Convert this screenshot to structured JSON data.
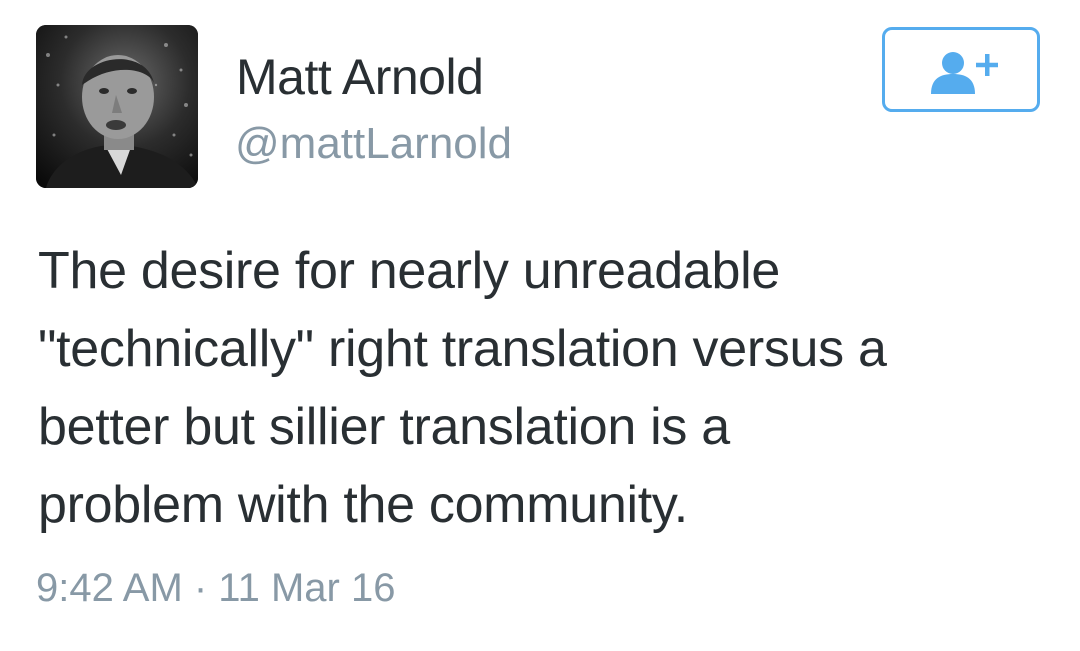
{
  "tweet": {
    "author": {
      "display_name": "Matt Arnold",
      "handle": "@mattLarnold",
      "avatar": "profile-photo"
    },
    "follow_button": {
      "icon": "follow-user-plus-icon",
      "accent_color": "#55acee"
    },
    "text_lines": [
      "The desire for nearly unreadable",
      "\"technically\" right translation versus a",
      "better but sillier translation is a",
      "problem with the community."
    ],
    "timestamp": "9:42 AM · 11 Mar 16"
  },
  "colors": {
    "text": "#292f33",
    "secondary_text": "#8899a6",
    "accent": "#55acee"
  }
}
